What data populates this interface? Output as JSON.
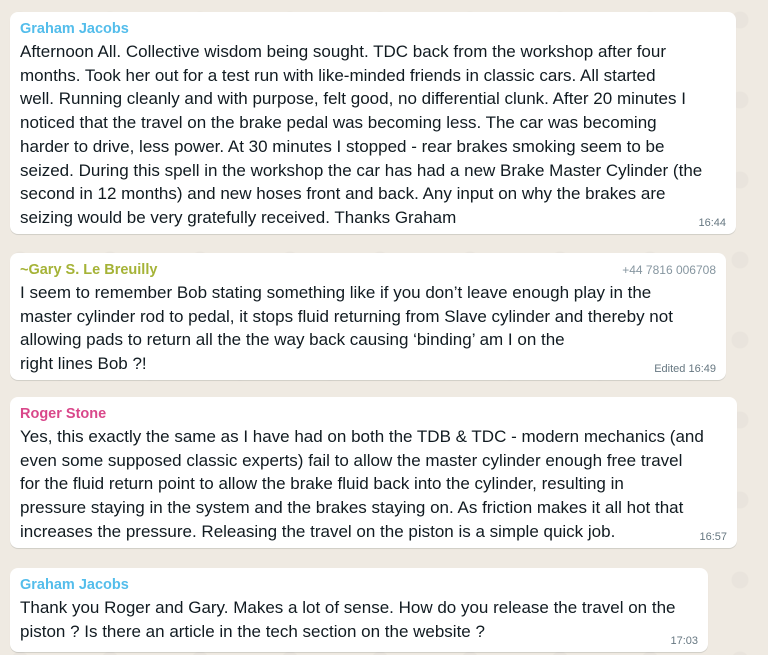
{
  "colors": {
    "background": "#efeae2",
    "bubble": "#ffffff",
    "graham": "#53bdeb",
    "gary": "#a5b337",
    "roger": "#d9478a",
    "meta": "#667781"
  },
  "messages": [
    {
      "sender": "Graham Jacobs",
      "phone": "",
      "text": "Afternoon All. Collective wisdom being sought. TDC back from the workshop after four\nmonths. Took her out for a test run with like-minded friends in classic cars. All started\nwell. Running cleanly and with purpose, felt good, no differential clunk. After 20 minutes I\nnoticed that the travel on the brake pedal was becoming less. The car was becoming\nharder to drive, less power. At 30 minutes I stopped - rear brakes smoking seem to be\nseized. During this spell in the workshop the car has had a new Brake Master Cylinder (the\nsecond in 12 months) and new hoses front and back. Any input on why the brakes are\nseizing would be very gratefully received. Thanks Graham",
      "time": "16:44"
    },
    {
      "sender": "~Gary S. Le Breuilly",
      "phone": "+44 7816 006708",
      "text": "I seem to remember Bob stating something like if you don’t leave enough play in the\nmaster cylinder rod to pedal, it stops fluid returning from Slave cylinder and thereby not\nallowing pads to return all the the way back causing ‘binding’ am I on the\nright lines Bob ?!",
      "time": "Edited 16:49"
    },
    {
      "sender": "Roger Stone",
      "phone": "",
      "text": "Yes, this exactly the same as I have had on both the TDB & TDC - modern mechanics (and\neven some supposed classic experts) fail to allow the master cylinder enough free travel\nfor the fluid return point to allow the brake fluid back into the cylinder, resulting in\npressure staying in the system and the brakes staying on.  As friction makes it all hot that\nincreases the pressure.  Releasing the travel on the piston is a simple quick job.",
      "time": "16:57"
    },
    {
      "sender": "Graham Jacobs",
      "phone": "",
      "text": "Thank you Roger and Gary. Makes a lot of sense. How do you release the travel on the\npiston ? Is there an article in the tech section on the website ?",
      "time": "17:03"
    }
  ]
}
